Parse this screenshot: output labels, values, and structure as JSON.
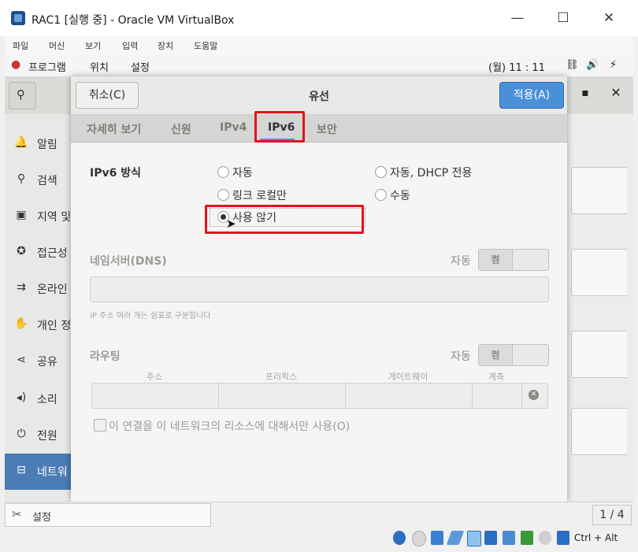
{
  "window": {
    "title": "RAC1 [실행 중] - Oracle VM VirtualBox",
    "minimize": "—",
    "maximize": "☐",
    "close": "✕"
  },
  "vbox_menu": [
    "파일",
    "머신",
    "보기",
    "입력",
    "장치",
    "도움말"
  ],
  "gnome_topbar": {
    "programs": "프로그램",
    "places": "위치",
    "settings": "설정",
    "clock": "(월) 11 : 11"
  },
  "sidebar": {
    "items": [
      {
        "label": "알림",
        "icon": "bell-icon"
      },
      {
        "label": "검색",
        "icon": "search-icon"
      },
      {
        "label": "지역 및",
        "icon": "camera-icon"
      },
      {
        "label": "접근성",
        "icon": "accessibility-icon"
      },
      {
        "label": "온라인",
        "icon": "online-accounts-icon"
      },
      {
        "label": "개인 정",
        "icon": "hand-icon"
      },
      {
        "label": "공유",
        "icon": "share-icon"
      },
      {
        "label": "소리",
        "icon": "speaker-icon"
      },
      {
        "label": "전원",
        "icon": "power-icon"
      },
      {
        "label": "네트워",
        "icon": "network-icon"
      }
    ]
  },
  "dialog": {
    "cancel_label": "취소(C)",
    "title": "유선",
    "apply_label": "적용(A)",
    "tabs": [
      {
        "label": "자세히 보기"
      },
      {
        "label": "신원"
      },
      {
        "label": "IPv4"
      },
      {
        "label": "IPv6"
      },
      {
        "label": "보안"
      }
    ],
    "ipv6_method": {
      "title": "IPv6 방식",
      "options": [
        {
          "label": "자동",
          "checked": false
        },
        {
          "label": "자동, DHCP 전용",
          "checked": false
        },
        {
          "label": "링크 로컬만",
          "checked": false
        },
        {
          "label": "수동",
          "checked": false
        },
        {
          "label": "사용 않기",
          "checked": true
        }
      ]
    },
    "dns": {
      "title": "네임서버(DNS)",
      "auto_label": "자동",
      "toggle_on": "켬",
      "hint": "IP 주소 여러 개는 쉼표로 구분합니다"
    },
    "routes": {
      "title": "라우팅",
      "auto_label": "자동",
      "toggle_on": "켬",
      "columns": [
        "주소",
        "프리픽스",
        "게이트웨이",
        "계측"
      ]
    },
    "only_local_label": "이 연결을 이 네트워크의 리소스에 대해서만 사용(O)"
  },
  "bottom": {
    "task_label": "설정",
    "page_indicator": "1 / 4"
  },
  "vbox_status": {
    "host_key": "Ctrl + Alt"
  }
}
